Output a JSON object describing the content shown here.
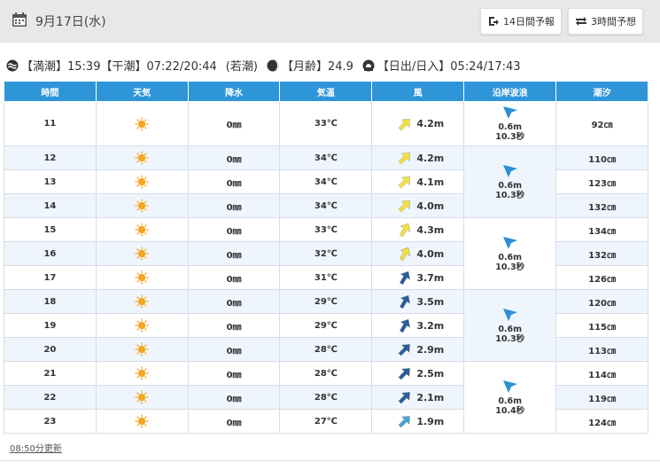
{
  "header": {
    "date": "9月17日(水)",
    "btn_14day": "14日間予報",
    "btn_3hour": "3時間予想"
  },
  "tide_info": {
    "high_tide": "【満潮】15:39",
    "low_tide": "【干潮】07:22/20:44",
    "tide_type": "(若潮)",
    "moon_age": "【月齢】24.9",
    "sunrise_sunset": "【日出/日入】05:24/17:43"
  },
  "table": {
    "headers": [
      "時間",
      "天気",
      "降水",
      "気温",
      "風",
      "沿岸波浪",
      "潮汐"
    ],
    "rows": [
      {
        "hour": "11",
        "precip": "0㎜",
        "temp": "33℃",
        "wind": "4.2m",
        "wind_dir": 45,
        "wind_color": "#f3e337",
        "tide": "92㎝"
      },
      {
        "hour": "12",
        "precip": "0㎜",
        "temp": "34℃",
        "wind": "4.2m",
        "wind_dir": 45,
        "wind_color": "#f3e337",
        "tide": "110㎝"
      },
      {
        "hour": "13",
        "precip": "0㎜",
        "temp": "34℃",
        "wind": "4.1m",
        "wind_dir": 45,
        "wind_color": "#f3e337",
        "tide": "123㎝"
      },
      {
        "hour": "14",
        "precip": "0㎜",
        "temp": "34℃",
        "wind": "4.0m",
        "wind_dir": 45,
        "wind_color": "#f3e337",
        "tide": "132㎝"
      },
      {
        "hour": "15",
        "precip": "0㎜",
        "temp": "33℃",
        "wind": "4.3m",
        "wind_dir": 30,
        "wind_color": "#f3e337",
        "tide": "134㎝"
      },
      {
        "hour": "16",
        "precip": "0㎜",
        "temp": "32℃",
        "wind": "4.0m",
        "wind_dir": 30,
        "wind_color": "#f3e337",
        "tide": "132㎝"
      },
      {
        "hour": "17",
        "precip": "0㎜",
        "temp": "31℃",
        "wind": "3.7m",
        "wind_dir": 30,
        "wind_color": "#2a5b9c",
        "tide": "126㎝"
      },
      {
        "hour": "18",
        "precip": "0㎜",
        "temp": "29℃",
        "wind": "3.5m",
        "wind_dir": 30,
        "wind_color": "#2a5b9c",
        "tide": "120㎝"
      },
      {
        "hour": "19",
        "precip": "0㎜",
        "temp": "29℃",
        "wind": "3.2m",
        "wind_dir": 30,
        "wind_color": "#2a5b9c",
        "tide": "115㎝"
      },
      {
        "hour": "20",
        "precip": "0㎜",
        "temp": "28℃",
        "wind": "2.9m",
        "wind_dir": 45,
        "wind_color": "#2a5b9c",
        "tide": "113㎝"
      },
      {
        "hour": "21",
        "precip": "0㎜",
        "temp": "28℃",
        "wind": "2.5m",
        "wind_dir": 45,
        "wind_color": "#2a5b9c",
        "tide": "114㎝"
      },
      {
        "hour": "22",
        "precip": "0㎜",
        "temp": "28℃",
        "wind": "2.1m",
        "wind_dir": 45,
        "wind_color": "#2a5b9c",
        "tide": "119㎝"
      },
      {
        "hour": "23",
        "precip": "0㎜",
        "temp": "27℃",
        "wind": "1.9m",
        "wind_dir": 45,
        "wind_color": "#4aa3d6",
        "tide": "124㎝"
      }
    ],
    "waves": [
      {
        "height": "0.6m",
        "period": "10.3秒",
        "rowspan": 1
      },
      {
        "height": "0.6m",
        "period": "10.3秒",
        "rowspan": 3
      },
      {
        "height": "0.6m",
        "period": "10.3秒",
        "rowspan": 3
      },
      {
        "height": "0.6m",
        "period": "10.3秒",
        "rowspan": 3
      },
      {
        "height": "0.6m",
        "period": "10.4秒",
        "rowspan": 3
      }
    ]
  },
  "footer": {
    "updated": "08:50分更新"
  },
  "colors": {
    "header_bg": "#2f95d9",
    "row_alt": "#eef5fc",
    "sun": "#f5a623",
    "wave_arrow": "#2a8fd6"
  }
}
